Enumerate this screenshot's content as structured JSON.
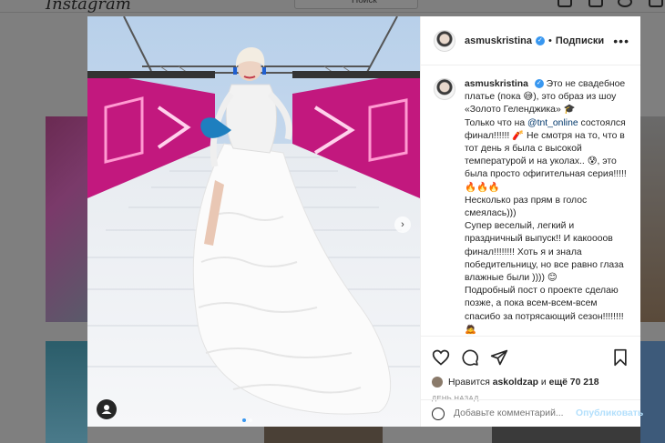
{
  "background": {
    "logo": "Instagram",
    "search_placeholder": "Поиск"
  },
  "post": {
    "author": "asmuskristina",
    "follow_separator": "•",
    "follow_label": "Подписки",
    "more_label": "•••",
    "caption_user": "asmuskristina",
    "caption_lines": [
      "Это не свадебное платье (пока 😅), это образ из шоу «Золото Геленджика» 🎓",
      "Только что на ",
      "@tnt_online",
      " состоялся финал!!!!!! 🧨 Не смотря на то, что в тот день я была с высокой температурой и на уколах.. 😰, это была просто офигительная серия!!!!! 🔥🔥🔥",
      "Несколько раз прям в голос смеялась)))",
      "Супер веселый, легкий и праздничный выпуск!! И какоооов финал!!!!!!!! Хоть я и знала победительницу, но все равно глаза влажные были )))) 😊",
      "Подробный пост о проекте сделаю позже, а пока всем-всем-всем спасибо за потрясающий сезон!!!!!!!! 🙇"
    ],
    "likes_prefix": "Нравится",
    "likes_user": "askoldzap",
    "likes_and": "и",
    "likes_more": "ещё 70 218",
    "time_ago": "ДЕНЬ НАЗАД",
    "comment_placeholder": "Добавьте комментарий...",
    "publish_label": "Опубликовать",
    "next_label": "›"
  },
  "colors": {
    "accent": "#3897f0",
    "publish_disabled": "#b2dffc",
    "mention": "#00376b"
  }
}
